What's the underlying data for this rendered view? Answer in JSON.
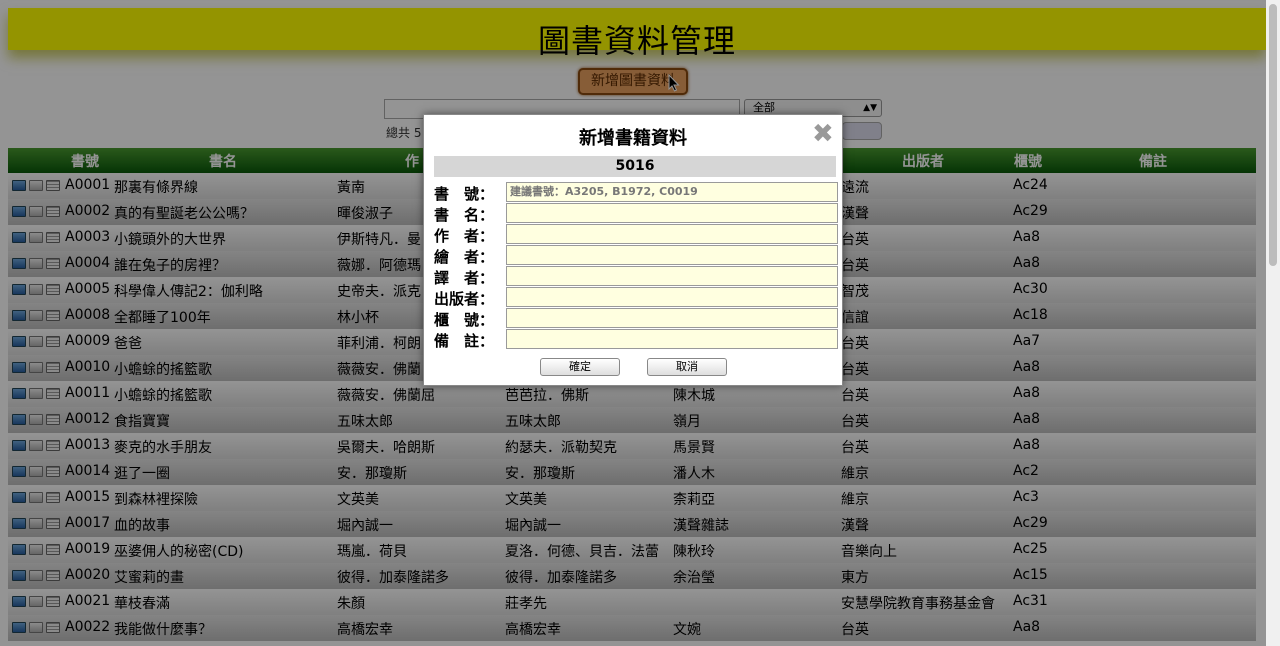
{
  "header": {
    "title": "圖書資料管理",
    "add_button": "新增圖書資料"
  },
  "filter": {
    "category_selected": "全部",
    "total_label": "總共 5"
  },
  "table": {
    "columns": [
      "書號",
      "書名",
      "作",
      "出版者",
      "櫃號",
      "備註"
    ],
    "rows": [
      {
        "id": "A0001",
        "title": "那裏有條界線",
        "author": "黃南",
        "illustrator": "",
        "translator": "",
        "publisher": "遠流",
        "shelf": "Ac24"
      },
      {
        "id": "A0002",
        "title": "真的有聖誕老公公嗎？",
        "author": "暉俊淑子",
        "illustrator": "",
        "translator": "",
        "publisher": "漢聲",
        "shelf": "Ac29"
      },
      {
        "id": "A0003",
        "title": "小鏡頭外的大世界",
        "author": "伊斯特凡．曼",
        "illustrator": "",
        "translator": "",
        "publisher": "台英",
        "shelf": "Aa8"
      },
      {
        "id": "A0004",
        "title": "誰在兔子的房裡？",
        "author": "薇娜．阿德瑪",
        "illustrator": "",
        "translator": "",
        "publisher": "台英",
        "shelf": "Aa8"
      },
      {
        "id": "A0005",
        "title": "科學偉人傳記2：伽利略",
        "author": "史帝夫．派克",
        "illustrator": "",
        "translator": "",
        "publisher": "智茂",
        "shelf": "Ac30"
      },
      {
        "id": "A0008",
        "title": "全都睡了100年",
        "author": "林小杯",
        "illustrator": "",
        "translator": "",
        "publisher": "信誼",
        "shelf": "Ac18"
      },
      {
        "id": "A0009",
        "title": "爸爸",
        "author": "菲利浦．柯朗",
        "illustrator": "",
        "translator": "",
        "publisher": "台英",
        "shelf": "Aa7"
      },
      {
        "id": "A0010",
        "title": "小蟾蜍的搖籃歌",
        "author": "薇薇安．佛蘭",
        "illustrator": "",
        "translator": "",
        "publisher": "台英",
        "shelf": "Aa8"
      },
      {
        "id": "A0011",
        "title": "小蟾蜍的搖籃歌",
        "author": "薇薇安．佛蘭屈",
        "illustrator": "芭芭拉．佛斯",
        "translator": "陳木城",
        "publisher": "台英",
        "shelf": "Aa8"
      },
      {
        "id": "A0012",
        "title": "食指寶寶",
        "author": "五味太郎",
        "illustrator": "五味太郎",
        "translator": "嶺月",
        "publisher": "台英",
        "shelf": "Aa8"
      },
      {
        "id": "A0013",
        "title": "麥克的水手朋友",
        "author": "吳爾夫．哈朗斯",
        "illustrator": "約瑟夫．派勒契克",
        "translator": "馬景賢",
        "publisher": "台英",
        "shelf": "Aa8"
      },
      {
        "id": "A0014",
        "title": "逛了一圈",
        "author": "安．那瓊斯",
        "illustrator": "安．那瓊斯",
        "translator": "潘人木",
        "publisher": "維京",
        "shelf": "Ac2"
      },
      {
        "id": "A0015",
        "title": "到森林裡探險",
        "author": "文英美",
        "illustrator": "文英美",
        "translator": "柰莉亞",
        "publisher": "維京",
        "shelf": "Ac3"
      },
      {
        "id": "A0017",
        "title": "血的故事",
        "author": "堀內誠一",
        "illustrator": "堀內誠一",
        "translator": "漢聲雜誌",
        "publisher": "漢聲",
        "shelf": "Ac29"
      },
      {
        "id": "A0019",
        "title": "巫婆佣人的秘密(CD)",
        "author": "瑪嵐．荷貝",
        "illustrator": "夏洛．何德、貝吉．法蕾",
        "translator": "陳秋玲",
        "publisher": "音樂向上",
        "shelf": "Ac25"
      },
      {
        "id": "A0020",
        "title": "艾蜜莉的畫",
        "author": "彼得．加泰隆諾多",
        "illustrator": "彼得．加泰隆諾多",
        "translator": "余治瑩",
        "publisher": "東方",
        "shelf": "Ac15"
      },
      {
        "id": "A0021",
        "title": "華枝春滿",
        "author": "朱顏",
        "illustrator": "莊孝先",
        "translator": "",
        "publisher": "安慧學院教育事務基金會",
        "shelf": "Ac31"
      },
      {
        "id": "A0022",
        "title": "我能做什麼事？",
        "author": "高橋宏幸",
        "illustrator": "高橋宏幸",
        "translator": "文婉",
        "publisher": "台英",
        "shelf": "Aa8"
      }
    ]
  },
  "modal": {
    "title": "新增書籍資料",
    "close": "✖",
    "book_count": "5016",
    "fields": [
      {
        "label": "書　號：",
        "value": "",
        "placeholder": "建議書號：A3205, B1972, C0019"
      },
      {
        "label": "書　名：",
        "value": "",
        "placeholder": ""
      },
      {
        "label": "作　者：",
        "value": "",
        "placeholder": ""
      },
      {
        "label": "繪　者：",
        "value": "",
        "placeholder": ""
      },
      {
        "label": "譯　者：",
        "value": "",
        "placeholder": ""
      },
      {
        "label": "出版者：",
        "value": "",
        "placeholder": ""
      },
      {
        "label": "櫃　號：",
        "value": "",
        "placeholder": ""
      },
      {
        "label": "備　註：",
        "value": "",
        "placeholder": ""
      }
    ],
    "confirm_button": "確定",
    "cancel_button": "取消"
  },
  "colors": {
    "header_bg": "#ffff00",
    "table_header": "#1f6f15",
    "input_bg": "#ffffe0",
    "add_button": "#e8a060"
  },
  "icons": [
    "edit-icon",
    "copy-icon",
    "list-icon",
    "close-icon",
    "dropdown-arrow-icon",
    "cursor-icon"
  ]
}
